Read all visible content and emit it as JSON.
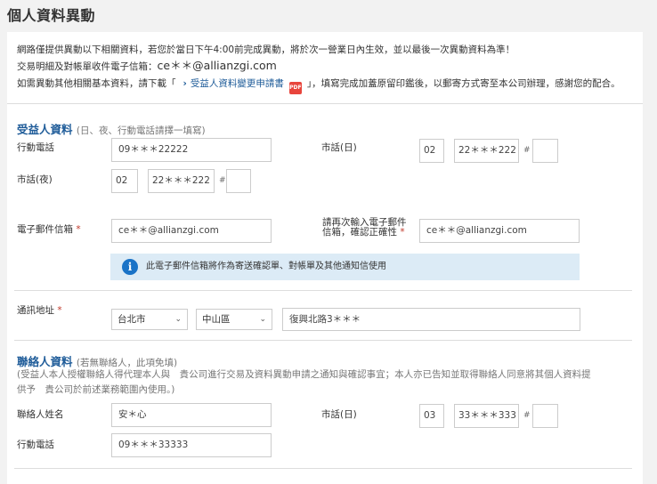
{
  "page": {
    "title": "個人資料異動"
  },
  "notice": {
    "line1": "網路僅提供異動以下相關資料，若您於當日下午4:00前完成異動，將於次一營業日內生效，並以最後一次異動資料為準！",
    "line2_prefix": "交易明細及對帳單收件電子信箱：",
    "line2_email": "ce＊＊@allianzgi.com",
    "line3_prefix": "如需異動其他相關基本資料，請下載「",
    "line3_link": "受益人資料變更申請書",
    "line3_suffix": "」，填寫完成加蓋原留印鑑後，以郵寄方式寄至本公司辦理，感謝您的配合。"
  },
  "beneficiary": {
    "title": "受益人資料",
    "subtitle": "(日、夜、行動電話請擇一填寫)",
    "mobile_label": "行動電話",
    "mobile_value": "09＊＊＊22222",
    "day_phone_label": "市話(日)",
    "day_area": "02",
    "day_number": "22＊＊＊222",
    "day_ext": "",
    "night_phone_label": "市話(夜)",
    "night_area": "02",
    "night_number": "22＊＊＊222",
    "night_ext": "",
    "hash": "#",
    "email_label": "電子郵件信箱",
    "email_value": "ce＊＊@allianzgi.com",
    "email_confirm_label_1": "請再次輸入電子郵件",
    "email_confirm_label_2": "信箱，確認正確性",
    "email_confirm_value": "ce＊＊@allianzgi.com",
    "info_text": "此電子郵件信箱將作為寄送確認單、對帳單及其他通知信使用",
    "address_label": "通訊地址",
    "city": "台北市",
    "district": "中山區",
    "street": "復興北路3＊＊＊",
    "required_mark": "*"
  },
  "contact": {
    "title": "聯絡人資料",
    "subtitle": "(若無聯絡人，此項免填)",
    "consent_1": "(受益人本人授權聯絡人得代理本人與　貴公司進行交易及資料異動申請之通知與確認事宜；本人亦已告知並取得聯絡人同意將其個人資料提",
    "consent_2": "供予　貴公司於前述業務範圍內使用。)",
    "name_label": "聯絡人姓名",
    "name_value": "安＊心",
    "day_phone_label": "市話(日)",
    "day_area": "03",
    "day_number": "33＊＊＊333",
    "day_ext": "",
    "mobile_label": "行動電話",
    "mobile_value": "09＊＊＊33333",
    "hash": "#"
  },
  "icons": {
    "chevron": "›",
    "pdf": "PDF",
    "info": "i",
    "select_arrow": "⌄"
  },
  "colors": {
    "accent": "#1f5c99",
    "info_bg": "#dcebf6",
    "required": "#c0392b"
  }
}
